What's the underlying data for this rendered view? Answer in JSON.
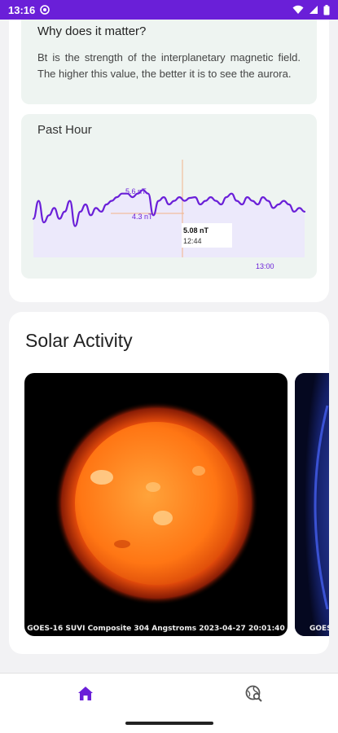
{
  "status_bar": {
    "time": "13:16"
  },
  "bt_section": {
    "why_title": "Why does it matter?",
    "why_text": "Bt is the strength of the interplanetary magnetic field. The higher this value, the better it is to see the aurora."
  },
  "past_hour": {
    "title": "Past Hour",
    "max_label": "5.6 nT",
    "min_label": "4.3 nT",
    "tooltip_value": "5.08 nT",
    "tooltip_time": "12:44",
    "x_tick": "13:00"
  },
  "chart_data": {
    "type": "line",
    "title": "Past Hour",
    "unit": "nT",
    "y_reference_labels": [
      "5.6 nT",
      "4.3 nT"
    ],
    "x_tick_labels": [
      "13:00"
    ],
    "highlight": {
      "time": "12:44",
      "value": 5.08
    },
    "values": [
      4.5,
      5.0,
      4.4,
      4.6,
      4.8,
      4.5,
      4.7,
      5.0,
      4.3,
      4.7,
      4.9,
      4.6,
      4.8,
      4.7,
      4.9,
      5.0,
      5.1,
      5.2,
      5.2,
      5.1,
      5.2,
      5.3,
      5.2,
      4.6,
      5.0,
      5.1,
      4.9,
      5.0,
      5.1,
      5.0,
      5.08,
      5.1,
      4.9,
      5.0,
      5.1,
      5.0,
      4.9,
      5.1,
      5.2,
      5.0,
      4.9,
      5.1,
      5.0,
      4.9,
      5.1,
      5.0,
      4.8,
      4.9,
      5.0,
      4.9,
      4.7,
      4.8,
      4.7
    ],
    "line_color": "#6a1fd8",
    "fill_color": "#ece9fb"
  },
  "solar_activity": {
    "title": "Solar Activity",
    "images": [
      {
        "caption": "GOES-16 SUVI Composite 304 Angstroms 2023-04-27 20:01:40"
      },
      {
        "caption": "GOES"
      }
    ]
  },
  "nav": {
    "items": [
      {
        "icon": "home-icon",
        "active": true
      },
      {
        "icon": "search-globe-icon",
        "active": false
      }
    ]
  },
  "colors": {
    "accent": "#6a1fd8",
    "card_tint": "#eef4f1"
  }
}
